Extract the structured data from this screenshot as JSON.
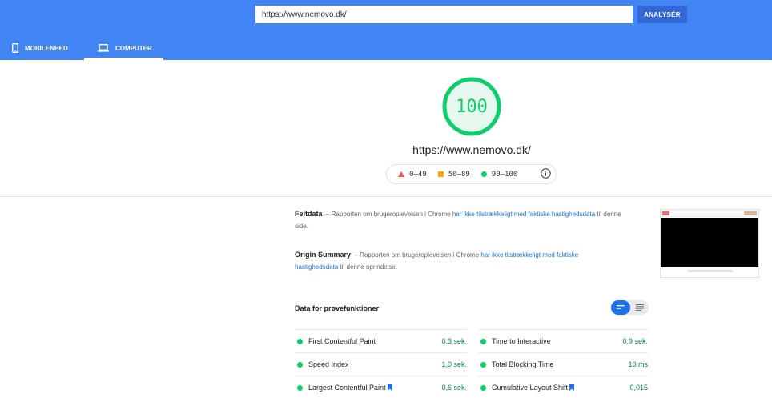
{
  "search": {
    "url_value": "https://www.nemovo.dk/",
    "analyze_label": "ANALYSÉR"
  },
  "tabs": [
    {
      "label": "MOBILENHED",
      "icon": "smartphone-icon",
      "active": false
    },
    {
      "label": "COMPUTER",
      "icon": "laptop-icon",
      "active": true
    }
  ],
  "score": {
    "value": "100",
    "url": "https://www.nemovo.dk/",
    "color": "#0cce6b"
  },
  "legend": [
    {
      "label": "0–49",
      "shape": "triangle",
      "color": "#ff4e42"
    },
    {
      "label": "50–89",
      "shape": "square",
      "color": "#ffa400"
    },
    {
      "label": "90–100",
      "shape": "circle",
      "color": "#0cce6b"
    }
  ],
  "field_data": {
    "title": "Feltdata",
    "dash": "–",
    "text_before": "Rapporten om brugeroplevelsen i Chrome",
    "link": "har ikke tilstrækkeligt med faktiske hastighedsdata",
    "text_after": "til denne side."
  },
  "origin_summary": {
    "title": "Origin Summary",
    "dash": "–",
    "text_before": "Rapporten om brugeroplevelsen i Chrome",
    "link": "har ikke tilstrækkeligt med faktiske hastighedsdata",
    "text_after": "til denne oprindelse."
  },
  "lab": {
    "title": "Data for prøvefunktioner",
    "metrics": [
      {
        "name": "First Contentful Paint",
        "value": "0,3 sek.",
        "bookmark": false
      },
      {
        "name": "Time to Interactive",
        "value": "0,9 sek.",
        "bookmark": false
      },
      {
        "name": "Speed Index",
        "value": "1,0 sek.",
        "bookmark": false
      },
      {
        "name": "Total Blocking Time",
        "value": "10 ms",
        "bookmark": false
      },
      {
        "name": "Largest Contentful Paint",
        "value": "0,6 sek.",
        "bookmark": true
      },
      {
        "name": "Cumulative Layout Shift",
        "value": "0,015",
        "bookmark": true
      }
    ]
  },
  "colors": {
    "header_bg": "#4285f4",
    "button_bg": "#3367d6",
    "pass": "#0cce6b",
    "pass_text": "#018642",
    "link": "#1a73e8"
  }
}
